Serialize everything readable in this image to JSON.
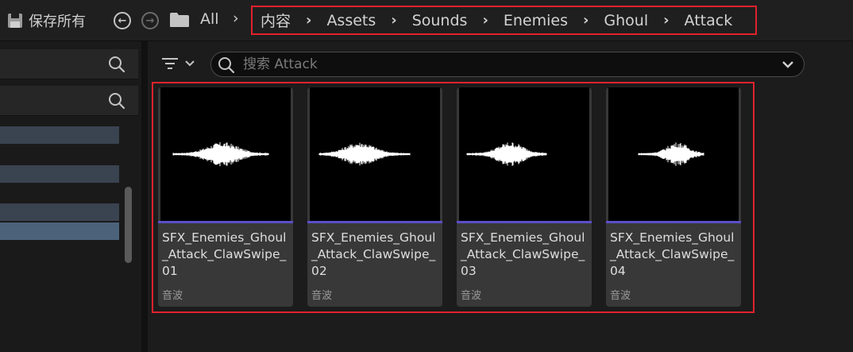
{
  "toolbar": {
    "save_all_label": "保存所有",
    "all_label": "All"
  },
  "breadcrumb": {
    "segments": [
      "内容",
      "Assets",
      "Sounds",
      "Enemies",
      "Ghoul",
      "Attack"
    ]
  },
  "content_browser": {
    "search_placeholder": "搜索 Attack",
    "assets": [
      {
        "name": "SFX_Enemies_Ghoul_Attack_ClawSwipe_01",
        "type": "音波"
      },
      {
        "name": "SFX_Enemies_Ghoul_Attack_ClawSwipe_02",
        "type": "音波"
      },
      {
        "name": "SFX_Enemies_Ghoul_Attack_ClawSwipe_03",
        "type": "音波"
      },
      {
        "name": "SFX_Enemies_Ghoul_Attack_ClawSwipe_04",
        "type": "音波"
      }
    ],
    "asset_type_color": "#5b4fc6",
    "highlight_color": "#e0222c"
  }
}
